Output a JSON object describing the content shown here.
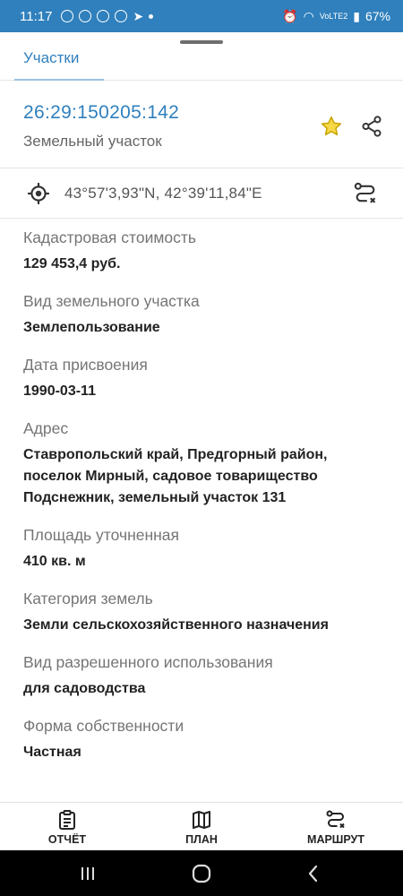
{
  "status_bar": {
    "time": "11:17",
    "battery": "67%",
    "network": "VoLTE2"
  },
  "tabs": [
    {
      "label": "Участки",
      "active": true
    }
  ],
  "header": {
    "cadastral_number": "26:29:150205:142",
    "object_type": "Земельный участок"
  },
  "coordinates": {
    "text": "43°57'3,93\"N, 42°39'11,84\"E"
  },
  "fields": [
    {
      "label": "Кадастровая стоимость",
      "value": "129 453,4 руб."
    },
    {
      "label": "Вид земельного участка",
      "value": "Землепользование"
    },
    {
      "label": "Дата присвоения",
      "value": "1990-03-11"
    },
    {
      "label": "Адрес",
      "value": "Ставропольский край, Предгорный район, поселок Мирный, садовое товарищество Подснежник, земельный участок 131"
    },
    {
      "label": "Площадь уточненная",
      "value": "410 кв. м"
    },
    {
      "label": "Категория земель",
      "value": "Земли сельскохозяйственного назначения"
    },
    {
      "label": "Вид разрешенного использования",
      "value": "для садоводства"
    },
    {
      "label": "Форма собственности",
      "value": "Частная"
    }
  ],
  "bottom_nav": {
    "report_label": "ОТЧЁТ",
    "plan_label": "ПЛАН",
    "route_label": "МАРШРУТ"
  },
  "colors": {
    "accent": "#2f80bd",
    "star": "#f2c200"
  },
  "icons": [
    "target-icon",
    "star-icon",
    "share-icon",
    "route-icon",
    "report-icon",
    "map-icon"
  ]
}
